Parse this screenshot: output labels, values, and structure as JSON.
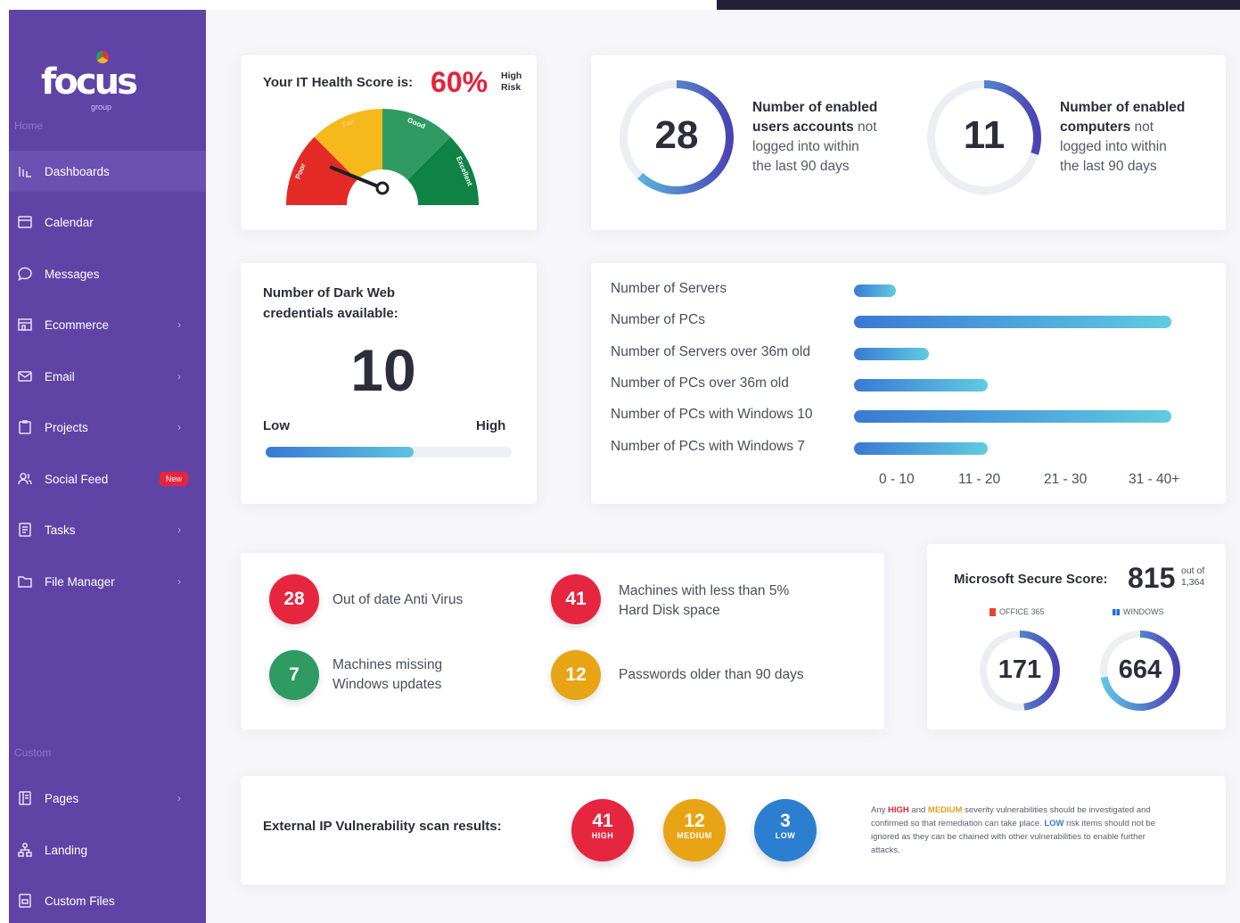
{
  "brand": {
    "name": "focus",
    "sub": "group"
  },
  "sidebar": {
    "section_home": "Home",
    "section_custom": "Custom",
    "items": [
      {
        "label": "Dashboards",
        "icon": "dashboard-icon",
        "chevron": false
      },
      {
        "label": "Calendar",
        "icon": "calendar-icon",
        "chevron": false
      },
      {
        "label": "Messages",
        "icon": "chat-bubble-icon",
        "chevron": false
      },
      {
        "label": "Ecommerce",
        "icon": "store-icon",
        "chevron": true
      },
      {
        "label": "Email",
        "icon": "envelope-icon",
        "chevron": true
      },
      {
        "label": "Projects",
        "icon": "clipboard-icon",
        "chevron": true
      },
      {
        "label": "Social Feed",
        "icon": "users-icon",
        "badge": "New"
      },
      {
        "label": "Tasks",
        "icon": "checklist-icon",
        "chevron": true
      },
      {
        "label": "File Manager",
        "icon": "folder-icon",
        "chevron": true
      }
    ],
    "custom_items": [
      {
        "label": "Pages",
        "icon": "pages-icon",
        "chevron": true
      },
      {
        "label": "Landing",
        "icon": "sitemap-icon",
        "chevron": false
      },
      {
        "label": "Custom Files",
        "icon": "file-icon",
        "chevron": false
      }
    ],
    "chevron_glyph": "›"
  },
  "health": {
    "title": "Your IT Health Score is:",
    "score": "60%",
    "risk_line1": "High",
    "risk_line2": "Risk",
    "score_value": 60,
    "segments": [
      {
        "label": "Poor",
        "color": "#e42a27"
      },
      {
        "label": "Fair",
        "color": "#f6b91b"
      },
      {
        "label": "Good",
        "color": "#2f9a62"
      },
      {
        "label": "Excellent",
        "color": "#0f8246"
      }
    ]
  },
  "stats": [
    {
      "value": "28",
      "line1_bold": "Number of enabled",
      "line2_bold": "users accounts",
      "line2_rest": " not",
      "line3": "logged into within",
      "line4": "the last 90 days",
      "fraction": 0.62
    },
    {
      "value": "11",
      "line1_bold": "Number of enabled",
      "line2_bold": "computers",
      "line2_rest": " not",
      "line3": "logged into within",
      "line4": "the last 90 days",
      "fraction": 0.3
    }
  ],
  "darkweb": {
    "title_line1": "Number of Dark Web",
    "title_line2": "credentials available:",
    "value": "10",
    "low_label": "Low",
    "high_label": "High",
    "fraction": 0.6
  },
  "inventory": {
    "rows": [
      {
        "label": "Number of Servers",
        "value": 5
      },
      {
        "label": "Number of PCs",
        "value": 38
      },
      {
        "label": "Number of Servers over 36m old",
        "value": 9
      },
      {
        "label": "Number of PCs over 36m old",
        "value": 16
      },
      {
        "label": "Number of PCs with Windows 10",
        "value": 38
      },
      {
        "label": "Number of PCs with Windows 7",
        "value": 16
      }
    ],
    "ticks": [
      "0 - 10",
      "11 - 20",
      "21 - 30",
      "31 - 40+"
    ],
    "max": 40
  },
  "issues": [
    {
      "value": "28",
      "color": "#e6263f",
      "line1": "Out of date Anti Virus",
      "line2": ""
    },
    {
      "value": "41",
      "color": "#e6263f",
      "line1": "Machines with less than 5%",
      "line2": "Hard Disk space"
    },
    {
      "value": "7",
      "color": "#2f9a62",
      "line1": "Machines missing",
      "line2": "Windows updates"
    },
    {
      "value": "12",
      "color": "#e8a414",
      "line1": "Passwords older than 90 days",
      "line2": ""
    }
  ],
  "ms_score": {
    "title": "Microsoft Secure Score:",
    "score": "815",
    "outof_line1": "out of",
    "outof_line2": "1,364",
    "office_label": "OFFICE 365",
    "windows_label": "WINDOWS",
    "office_value": "171",
    "windows_value": "664",
    "office_fraction": 0.48,
    "windows_fraction": 0.72
  },
  "vuln": {
    "title": "External IP Vulnerability scan results:",
    "items": [
      {
        "value": "41",
        "label": "HIGH",
        "color": "#e6263f"
      },
      {
        "value": "12",
        "label": "MEDIUM",
        "color": "#e8a414"
      },
      {
        "value": "3",
        "label": "LOW",
        "color": "#2c7fd0"
      }
    ],
    "note": {
      "p1": "Any ",
      "high": "HIGH",
      "p2": " and ",
      "medium": "MEDIUM",
      "p3": " severity vulnerabilities should be investigated and confirmed so that remediation can take place. ",
      "low": "LOW",
      "p4": " risk items should not be ignored as they can be chained with other vulnerabilities to enable further attacks."
    }
  }
}
